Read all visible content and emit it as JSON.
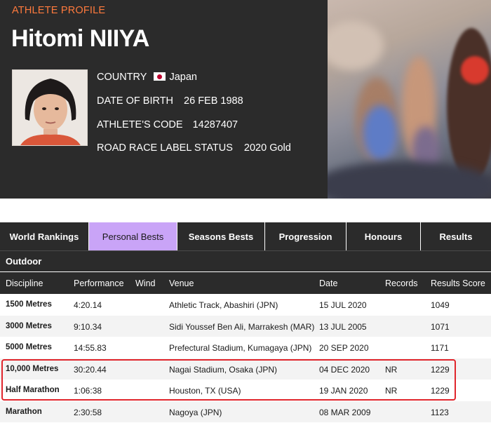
{
  "header": {
    "eyebrow": "ATHLETE PROFILE",
    "name": "Hitomi NIIYA",
    "country_label": "COUNTRY",
    "country_value": "Japan",
    "dob_label": "DATE OF BIRTH",
    "dob_value": "26 FEB 1988",
    "code_label": "ATHLETE'S CODE",
    "code_value": "14287407",
    "label_status_label": "ROAD RACE LABEL STATUS",
    "label_status_value": "2020 Gold",
    "accent_color": "#ff7a3d"
  },
  "tabs": [
    {
      "label": "World Rankings"
    },
    {
      "label": "Personal Bests"
    },
    {
      "label": "Seasons Bests"
    },
    {
      "label": "Progression"
    },
    {
      "label": "Honours"
    },
    {
      "label": "Results"
    }
  ],
  "active_tab": "Personal Bests",
  "active_tab_color": "#c9a4f7",
  "table": {
    "section": "Outdoor",
    "columns": [
      "Discipline",
      "Performance",
      "Wind",
      "Venue",
      "Date",
      "Records",
      "Results Score"
    ],
    "rows": [
      {
        "discipline": "1500 Metres",
        "performance": "4:20.14",
        "wind": "",
        "venue": "Athletic Track, Abashiri (JPN)",
        "date": "15 JUL 2020",
        "records": "",
        "score": "1049"
      },
      {
        "discipline": "3000 Metres",
        "performance": "9:10.34",
        "wind": "",
        "venue": "Sidi Youssef Ben Ali, Marrakesh (MAR)",
        "date": "13 JUL 2005",
        "records": "",
        "score": "1071"
      },
      {
        "discipline": "5000 Metres",
        "performance": "14:55.83",
        "wind": "",
        "venue": "Prefectural Stadium, Kumagaya (JPN)",
        "date": "20 SEP 2020",
        "records": "",
        "score": "1171"
      },
      {
        "discipline": "10,000 Metres",
        "performance": "30:20.44",
        "wind": "",
        "venue": "Nagai Stadium, Osaka (JPN)",
        "date": "04 DEC 2020",
        "records": "NR",
        "score": "1229"
      },
      {
        "discipline": "Half Marathon",
        "performance": "1:06:38",
        "wind": "",
        "venue": "Houston, TX (USA)",
        "date": "19 JAN 2020",
        "records": "NR",
        "score": "1229"
      },
      {
        "discipline": "Marathon",
        "performance": "2:30:58",
        "wind": "",
        "venue": "Nagoya (JPN)",
        "date": "08 MAR 2009",
        "records": "",
        "score": "1123"
      }
    ]
  },
  "highlight_color": "#e0252c"
}
